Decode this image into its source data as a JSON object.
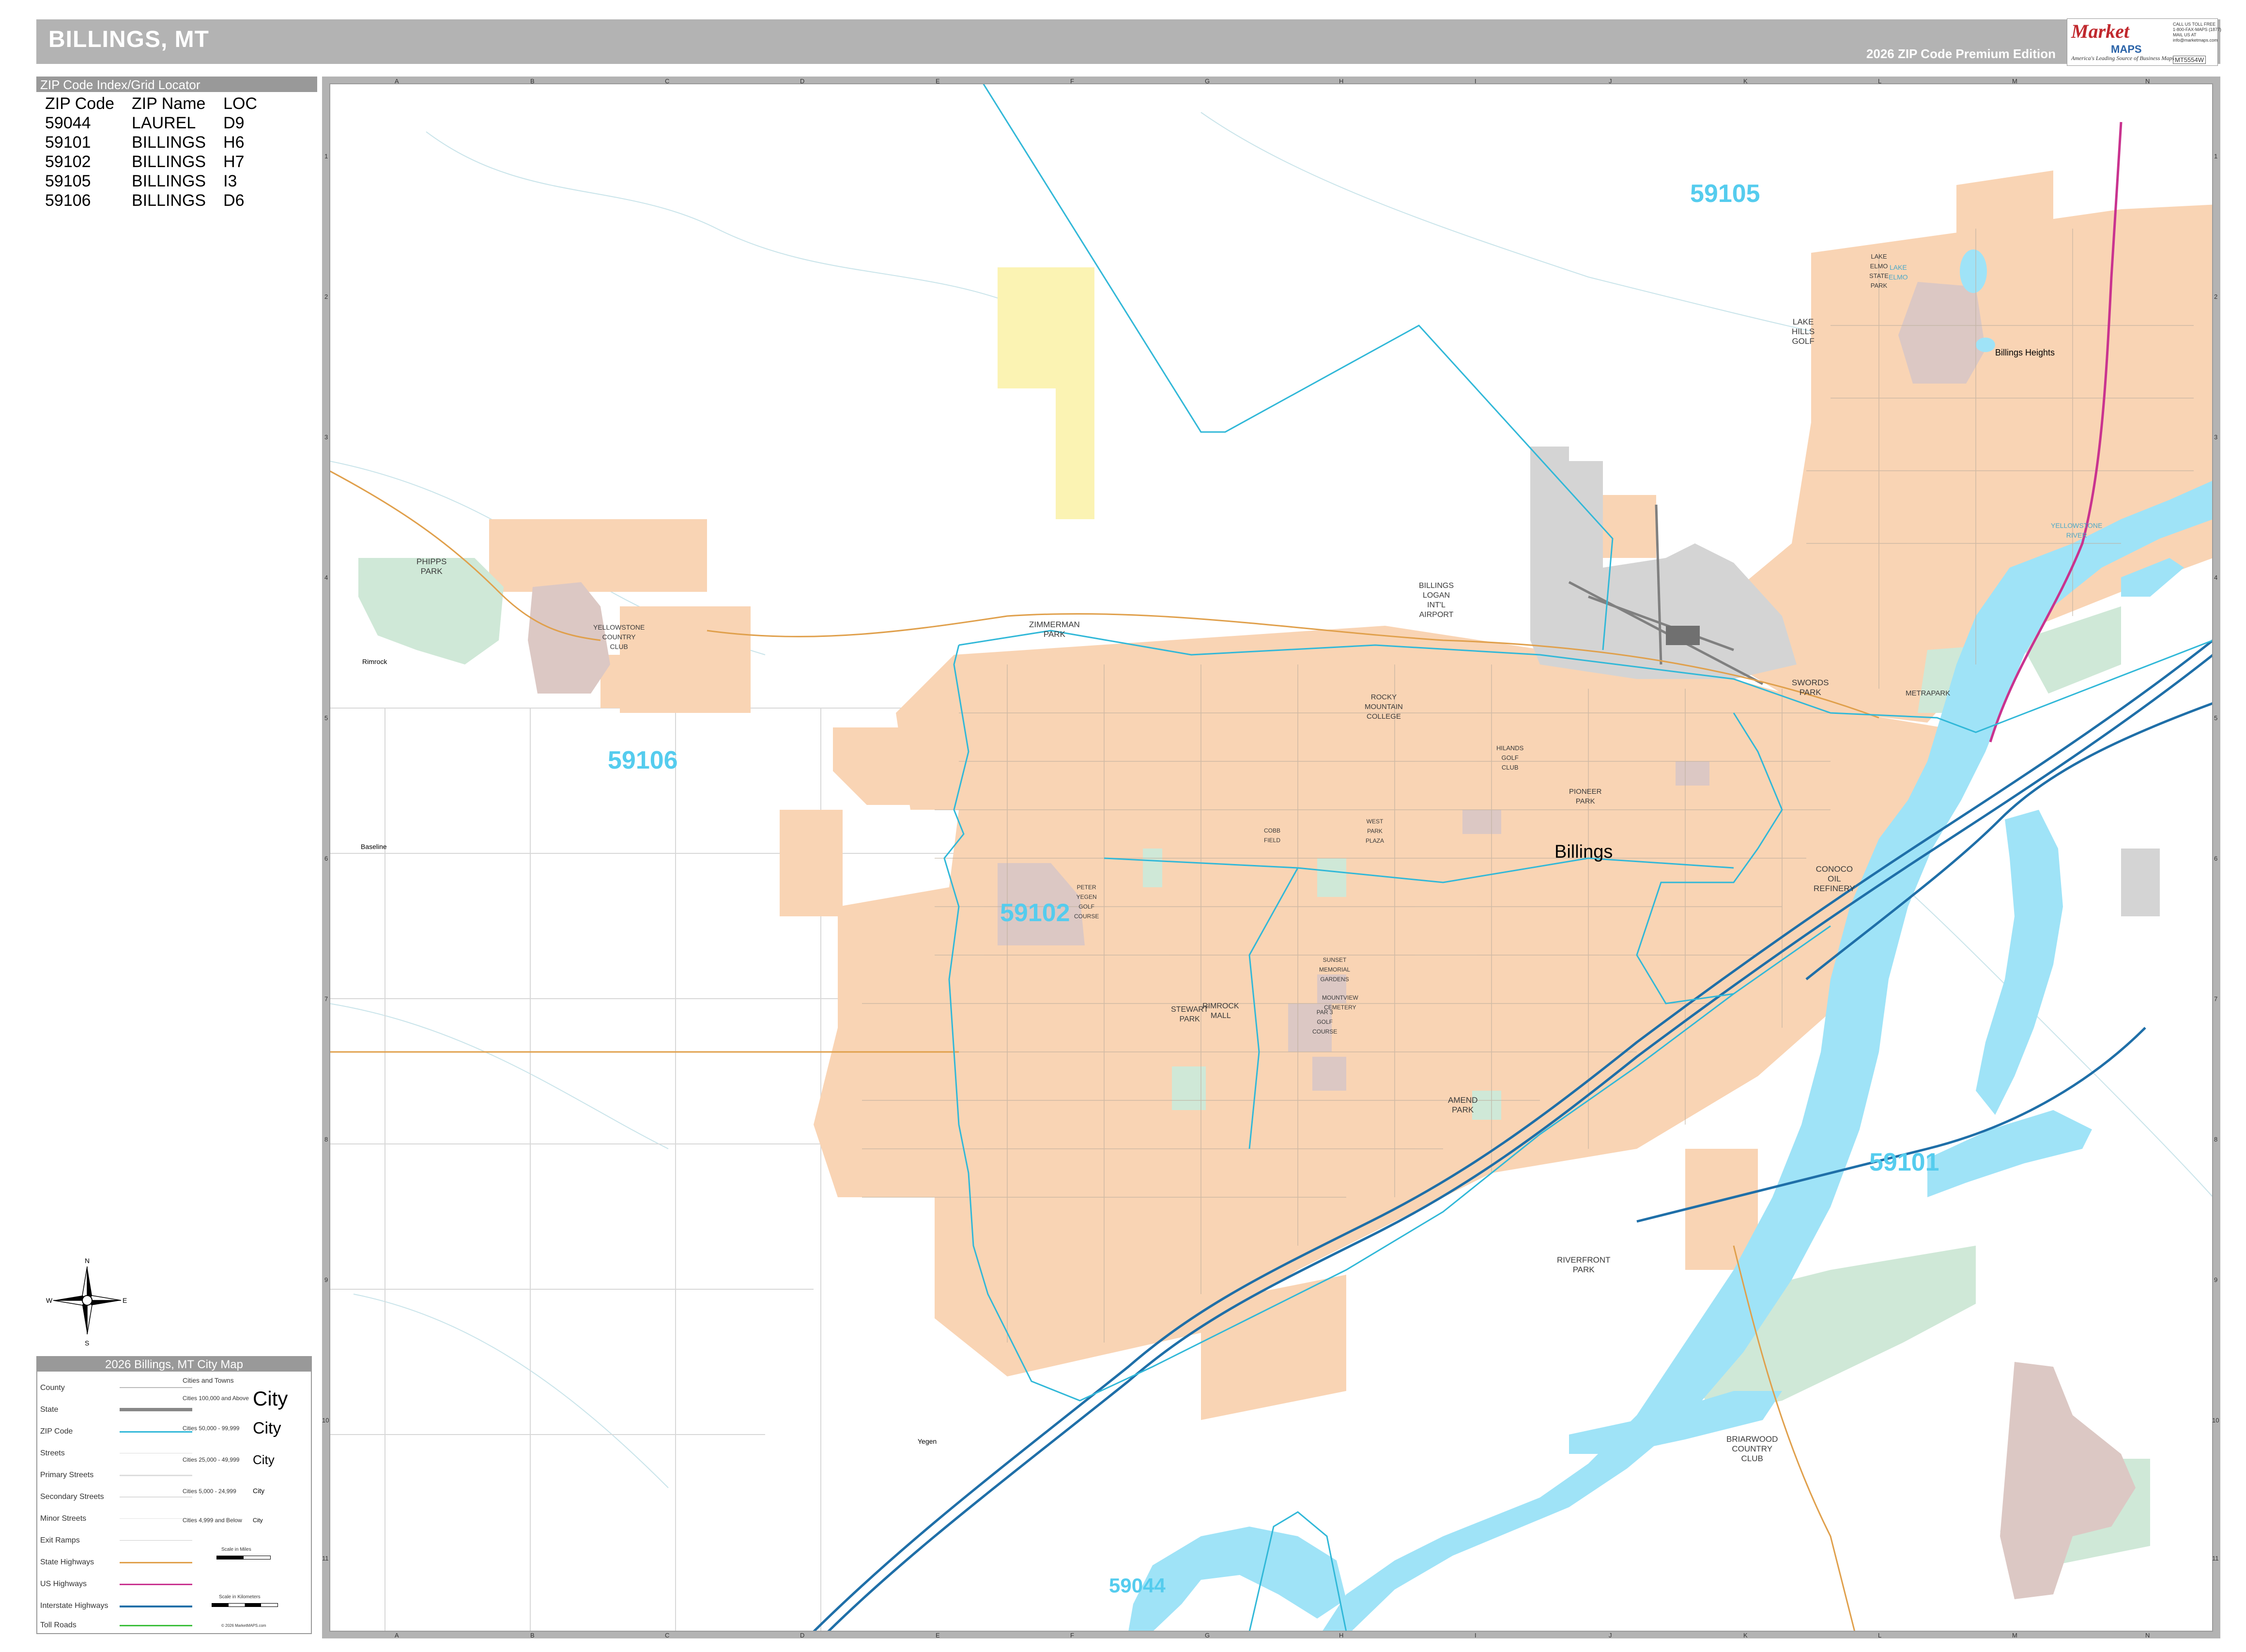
{
  "header": {
    "title": "BILLINGS, MT",
    "edition": "2026 ZIP Code Premium Edition"
  },
  "logo": {
    "brand": "Market",
    "maps": "MAPS",
    "tagline": "On Target. On Time.",
    "subline": "America's Leading Source of Business Maps",
    "contact": "CALL US TOLL FREE\n1-800-FAX-MAPS (1877)\nMAIL US AT\ninfo@marketmaps.com",
    "code": "MT5554W"
  },
  "zip_index": {
    "heading": "ZIP Code Index/Grid Locator",
    "columns": [
      "ZIP Code",
      "ZIP Name",
      "LOC"
    ],
    "rows": [
      [
        "59044",
        "LAUREL",
        "D9"
      ],
      [
        "59101",
        "BILLINGS",
        "H6"
      ],
      [
        "59102",
        "BILLINGS",
        "H7"
      ],
      [
        "59105",
        "BILLINGS",
        "I3"
      ],
      [
        "59106",
        "BILLINGS",
        "D6"
      ]
    ]
  },
  "grid": {
    "columns": [
      "A",
      "B",
      "C",
      "D",
      "E",
      "F",
      "G",
      "H",
      "I",
      "J",
      "K",
      "L",
      "M",
      "N"
    ],
    "rows": [
      "1",
      "2",
      "3",
      "4",
      "5",
      "6",
      "7",
      "8",
      "9",
      "10",
      "11"
    ]
  },
  "map": {
    "zip_labels": [
      "59105",
      "59106",
      "59102",
      "59101",
      "59044"
    ],
    "city_label": "Billings",
    "small_towns": [
      "Billings Heights",
      "Rimrock",
      "Baseline",
      "Yegen"
    ],
    "place_labels": {
      "phipps_park": "PHIPPS\nPARK",
      "yellowstone_cc": "YELLOWSTONE\nCOUNTRY\nCLUB",
      "zimmerman_park": "ZIMMERMAN\nPARK",
      "airport": "BILLINGS\nLOGAN\nINT'L\nAIRPORT",
      "rocky_mountain_college": "ROCKY\nMOUNTAIN\nCOLLEGE",
      "hilands_golf": "HILANDS\nGOLF\nCLUB",
      "pioneer_park": "PIONEER\nPARK",
      "swords_park": "SWORDS\nPARK",
      "metrapark": "METRAPARK",
      "lake_elmo_sp": "LAKE\nELMO\nSTATE\nPARK",
      "lake_elmo": "LAKE\nELMO",
      "lake_hills_golf": "LAKE\nHILLS\nGOLF",
      "yellowstone_river": "YELLOWSTONE\nRIVER",
      "conoco": "CONOCO\nOIL\nREFINERY",
      "peter_yegen_golf": "PETER\nYEGEN\nGOLF\nCOURSE",
      "west_park_plaza": "WEST\nPARK\nPLAZA",
      "sunset_memorial": "SUNSET\nMEMORIAL\nGARDENS",
      "mountview_cemetery": "MOUNTVIEW\nCEMETERY",
      "par3_golf": "PAR 3\nGOLF\nCOURSE",
      "stewart_park": "STEWART\nPARK",
      "rimrock_mall": "RIMROCK\nMALL",
      "amend_park": "AMEND\nPARK",
      "riverfront_park": "RIVERFRONT\nPARK",
      "briarwood_cc": "BRIARWOOD\nCOUNTRY\nCLUB",
      "cobb_field": "COBB\nFIELD"
    }
  },
  "colors": {
    "header_bg": "#b3b3b3",
    "urban": "#f9d4b4",
    "park": "#cfe8d7",
    "golf": "#dcc8c4",
    "water": "#9fe3f7",
    "airport": "#d4d4d4",
    "zip_boundary": "#31b8d8",
    "interstate": "#1f6fa8",
    "us_highway": "#c9338f",
    "state_highway": "#e0a04c",
    "zip_label": "#55ccee"
  },
  "legend": {
    "title": "2026 Billings, MT City Map",
    "items": [
      "County",
      "State",
      "ZIP Code",
      "Streets",
      "Primary Streets",
      "Secondary Streets",
      "Minor Streets",
      "Exit Ramps",
      "State Highways",
      "US Highways",
      "Interstate Highways",
      "Toll Roads"
    ],
    "cities_heading": "Cities and Towns",
    "city_classes": [
      "Cities 100,000 and Above",
      "Cities 50,000 - 99,999",
      "Cities 25,000 - 49,999",
      "Cities 5,000 - 24,999",
      "Cities 4,999 and Below"
    ],
    "city_sample": "City",
    "scale_miles": "Scale in Miles",
    "scale_km": "Scale in Kilometers",
    "copyright": "© 2026 MarketMAPS.com"
  },
  "compass": {
    "n": "N",
    "s": "S",
    "e": "E",
    "w": "W"
  }
}
